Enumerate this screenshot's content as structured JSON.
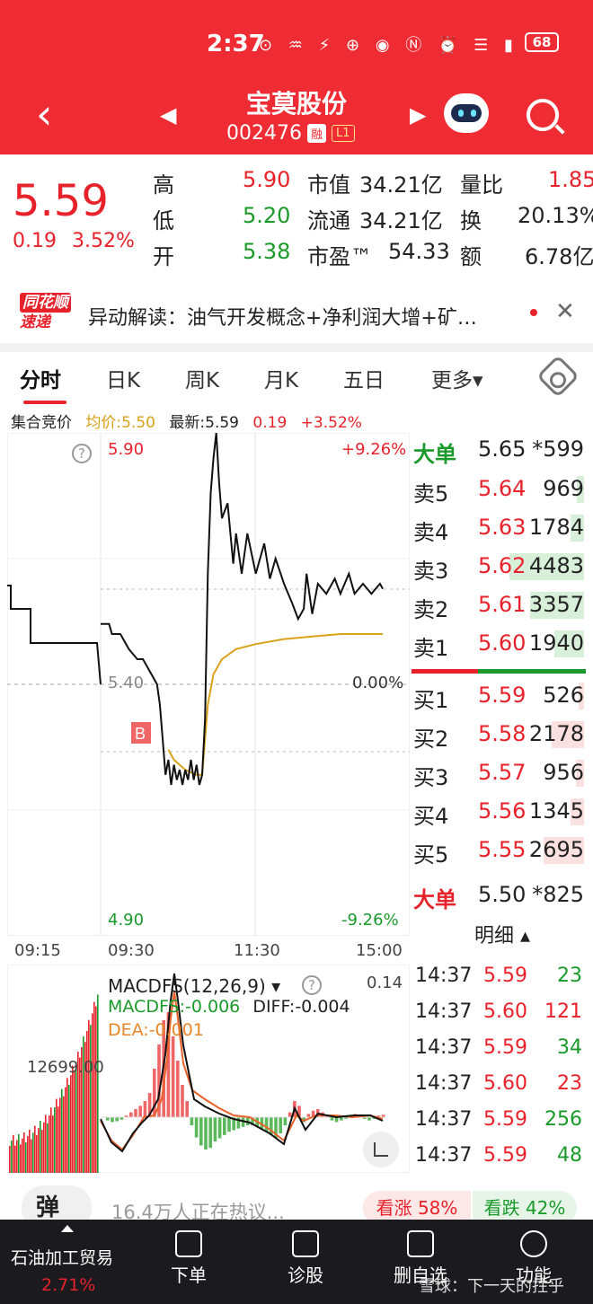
{
  "status": {
    "time": "2:37",
    "battery": "68",
    "icons": "⊙ ♒ ⚡ ⊕ ◉ Ⓝ ⏰ ☰ ▮"
  },
  "header": {
    "title": "宝莫股份",
    "code": "002476",
    "tag_rong": "融",
    "tag_l1": "L1"
  },
  "quote": {
    "price": "5.59",
    "change": "0.19",
    "pct": "3.52%",
    "rows": [
      {
        "l1": "高",
        "v1": "5.90",
        "l2": "市值",
        "v2": "34.21亿",
        "l3": "量比",
        "v3": "1.85"
      },
      {
        "l1": "低",
        "v1": "5.20",
        "l2": "流通",
        "v2": "34.21亿",
        "l3": "换",
        "v3": "20.13%"
      },
      {
        "l1": "开",
        "v1": "5.38",
        "l2": "市盈™",
        "v2": "54.33",
        "l3": "额",
        "v3": "6.78亿"
      }
    ]
  },
  "news": {
    "logo_l1": "同花顺",
    "logo_l2": "速递",
    "text": "异动解读：油气开发概念+净利润大增+矿…"
  },
  "tabs": [
    "分时",
    "日K",
    "周K",
    "月K",
    "五日",
    "更多▾"
  ],
  "infobar": {
    "auction": "集合竞价",
    "avg": "均价:5.50",
    "latest": "最新:5.59",
    "chg": "0.19",
    "pct": "+3.52%"
  },
  "chart_axis": {
    "high": "5.90",
    "mid": "5.40",
    "low": "4.90",
    "pct_high": "+9.26%",
    "pct_mid": "0.00%",
    "pct_low": "-9.26%",
    "help": "?",
    "b_marker": "B"
  },
  "time_axis": [
    "09:15",
    "09:30",
    "11:30",
    "15:00"
  ],
  "chart_data": {
    "type": "line",
    "ylim": [
      4.9,
      5.9
    ],
    "series": [
      {
        "name": "最新",
        "color": "#111111",
        "points": [
          [
            0,
            5.52
          ],
          [
            3,
            5.52
          ],
          [
            4,
            5.5
          ],
          [
            7,
            5.5
          ],
          [
            10,
            5.47
          ],
          [
            13,
            5.45
          ],
          [
            15,
            5.45
          ],
          [
            18,
            5.42
          ],
          [
            20,
            5.4
          ],
          [
            21,
            5.36
          ],
          [
            22,
            5.29
          ],
          [
            23,
            5.22
          ],
          [
            24,
            5.25
          ],
          [
            25,
            5.2
          ],
          [
            26,
            5.24
          ],
          [
            27,
            5.21
          ],
          [
            28,
            5.23
          ],
          [
            29,
            5.2
          ],
          [
            30,
            5.23
          ],
          [
            31,
            5.21
          ],
          [
            32,
            5.25
          ],
          [
            33,
            5.21
          ],
          [
            34,
            5.24
          ],
          [
            35,
            5.2
          ],
          [
            36,
            5.22
          ],
          [
            37,
            5.33
          ],
          [
            38,
            5.62
          ],
          [
            39,
            5.78
          ],
          [
            40,
            5.85
          ],
          [
            41,
            5.9
          ],
          [
            42,
            5.8
          ],
          [
            43,
            5.73
          ],
          [
            45,
            5.76
          ],
          [
            47,
            5.64
          ],
          [
            48,
            5.7
          ],
          [
            50,
            5.62
          ],
          [
            52,
            5.7
          ],
          [
            55,
            5.62
          ],
          [
            58,
            5.68
          ],
          [
            60,
            5.61
          ],
          [
            62,
            5.65
          ],
          [
            65,
            5.6
          ],
          [
            68,
            5.56
          ],
          [
            70,
            5.53
          ],
          [
            72,
            5.55
          ],
          [
            73,
            5.62
          ],
          [
            75,
            5.54
          ],
          [
            77,
            5.6
          ],
          [
            80,
            5.58
          ],
          [
            83,
            5.61
          ],
          [
            85,
            5.58
          ],
          [
            88,
            5.62
          ],
          [
            90,
            5.58
          ],
          [
            93,
            5.6
          ],
          [
            96,
            5.58
          ],
          [
            99,
            5.6
          ],
          [
            100,
            5.59
          ]
        ]
      },
      {
        "name": "均价",
        "color": "#d9a21a",
        "points": [
          [
            24,
            5.27
          ],
          [
            26,
            5.25
          ],
          [
            30,
            5.23
          ],
          [
            34,
            5.22
          ],
          [
            36,
            5.22
          ],
          [
            38,
            5.36
          ],
          [
            40,
            5.42
          ],
          [
            43,
            5.45
          ],
          [
            48,
            5.47
          ],
          [
            55,
            5.48
          ],
          [
            65,
            5.49
          ],
          [
            75,
            5.495
          ],
          [
            85,
            5.5
          ],
          [
            100,
            5.5
          ]
        ]
      }
    ]
  },
  "macd": {
    "title": "MACDFS(12,26,9) ▾",
    "macd": "MACDFS:-0.006",
    "diff": "DIFF:-0.004",
    "dea": "DEA:-0.001",
    "right_val": "0.14",
    "vol_val": "12699.00"
  },
  "book": {
    "big_sell": {
      "label": "大单",
      "price": "5.65",
      "vol": "*599"
    },
    "sells": [
      {
        "label": "卖5",
        "price": "5.64",
        "vol": "969",
        "fill": 0.05
      },
      {
        "label": "卖4",
        "price": "5.63",
        "vol": "1784",
        "fill": 0.1
      },
      {
        "label": "卖3",
        "price": "5.62",
        "vol": "4483",
        "fill": 0.55
      },
      {
        "label": "卖2",
        "price": "5.61",
        "vol": "3357",
        "fill": 0.4
      },
      {
        "label": "卖1",
        "price": "5.60",
        "vol": "1940",
        "fill": 0.22
      }
    ],
    "buys": [
      {
        "label": "买1",
        "price": "5.59",
        "vol": "526",
        "fill": 0.04
      },
      {
        "label": "买2",
        "price": "5.58",
        "vol": "2178",
        "fill": 0.24
      },
      {
        "label": "买3",
        "price": "5.57",
        "vol": "956",
        "fill": 0.06
      },
      {
        "label": "买4",
        "price": "5.56",
        "vol": "1345",
        "fill": 0.1
      },
      {
        "label": "买5",
        "price": "5.55",
        "vol": "2695",
        "fill": 0.3
      }
    ],
    "big_buy": {
      "label": "大单",
      "price": "5.50",
      "vol": "*825"
    },
    "detail_label": "明细 ▴"
  },
  "ticks": [
    {
      "time": "14:37",
      "price": "5.59",
      "vol": "23",
      "color": "green"
    },
    {
      "time": "14:37",
      "price": "5.60",
      "vol": "121",
      "color": "red"
    },
    {
      "time": "14:37",
      "price": "5.59",
      "vol": "34",
      "color": "green"
    },
    {
      "time": "14:37",
      "price": "5.60",
      "vol": "23",
      "color": "red"
    },
    {
      "time": "14:37",
      "price": "5.59",
      "vol": "256",
      "color": "green"
    },
    {
      "time": "14:37",
      "price": "5.59",
      "vol": "48",
      "color": "green"
    }
  ],
  "discuss": {
    "dan": "弹",
    "hot": "16.4万人正在热议...",
    "up": "看涨 58%",
    "down": "看跌 42%"
  },
  "nav": {
    "sector": "石油加工贸易",
    "sector_pct": "2.71%",
    "items": [
      "下单",
      "诊股",
      "删自选",
      "功能"
    ],
    "watermark": "雪球：下一天的拄乎"
  }
}
